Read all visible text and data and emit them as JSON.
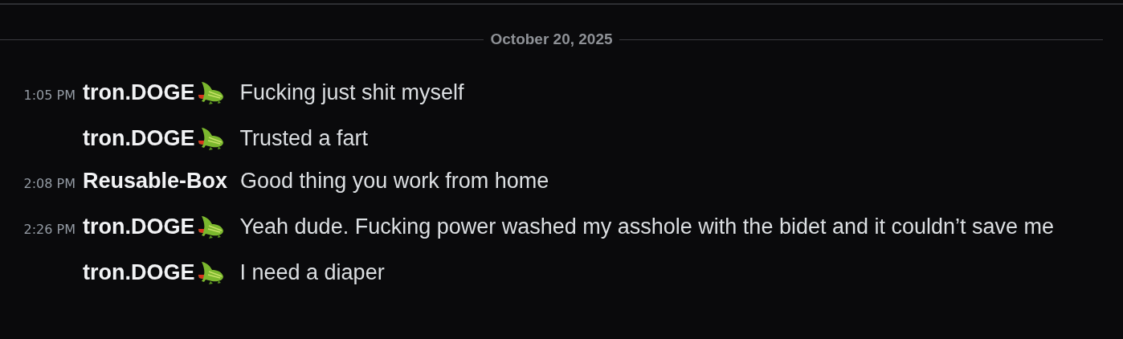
{
  "date_divider": {
    "label": "October 20, 2025"
  },
  "messages": [
    {
      "time": "1:05 PM",
      "author": "tron.DOGE",
      "kind": "tagged",
      "text": "Fucking just shit myself"
    },
    {
      "author": "tron.DOGE",
      "kind": "tagged",
      "text": "Trusted a fart"
    },
    {
      "time": "2:08 PM",
      "author": "Reusable-Box",
      "kind": "plain",
      "text": "Good thing you work from home"
    },
    {
      "time": "2:26 PM",
      "author": "tron.DOGE",
      "kind": "tagged",
      "text": "Yeah dude. Fucking power washed my asshole with the bidet and it couldn’t save me"
    },
    {
      "author": "tron.DOGE",
      "kind": "tagged",
      "text": "I need a diaper"
    }
  ]
}
